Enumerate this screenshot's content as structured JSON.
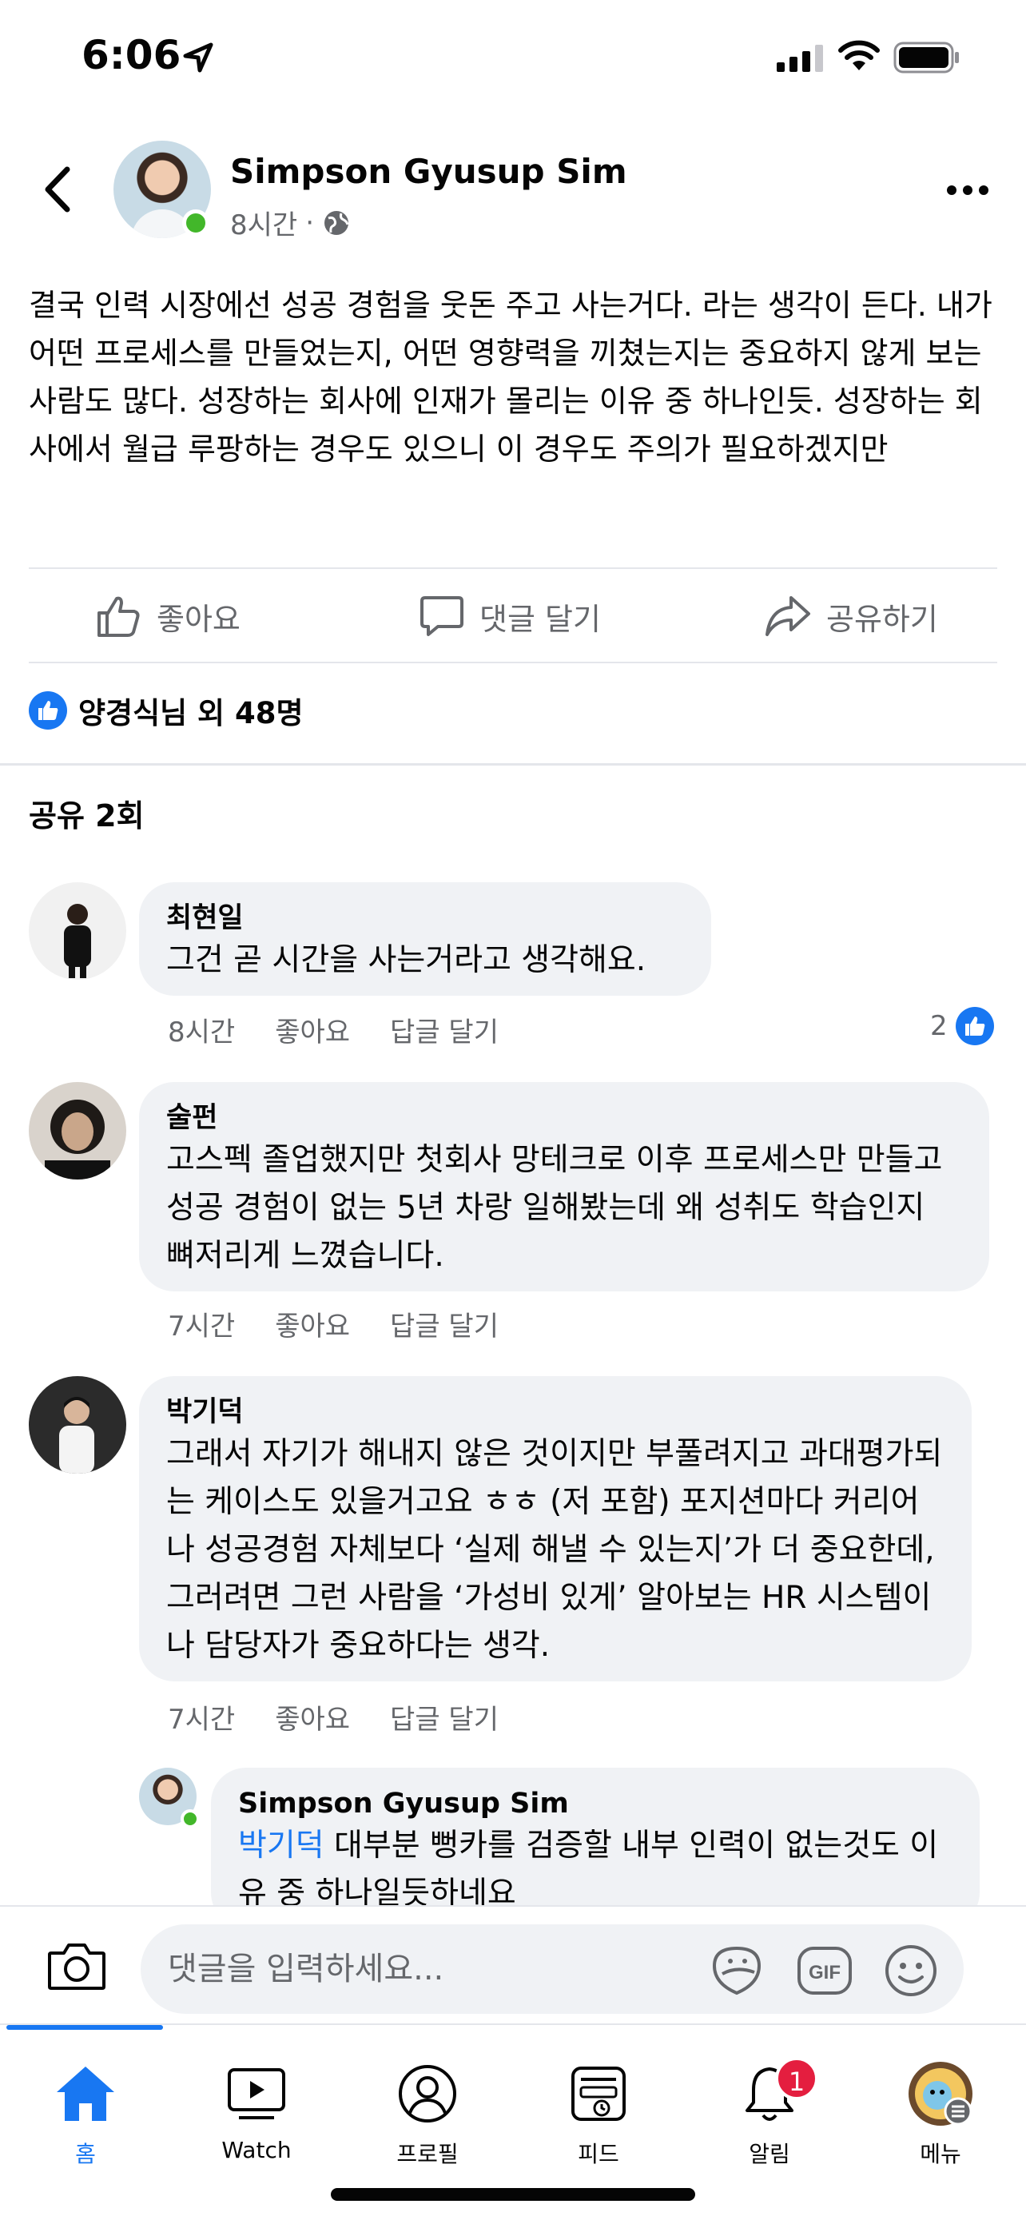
{
  "status_bar": {
    "time": "6:06"
  },
  "post": {
    "author": "Simpson Gyusup Sim",
    "time": "8시간",
    "meta_separator": "·",
    "privacy_icon": "globe-icon",
    "body": "결국 인력 시장에선 성공 경험을 웃돈 주고 사는거다. 라는 생각이 든다. 내가 어떤 프로세스를 만들었는지, 어떤 영향력을 끼쳤는지는 중요하지 않게 보는 사람도 많다. 성장하는 회사에 인재가 몰리는 이유 중 하나인듯. 성장하는 회사에서 월급 루팡하는 경우도 있으니 이 경우도 주의가 필요하겠지만"
  },
  "actions": {
    "like": "좋아요",
    "comment": "댓글 달기",
    "share": "공유하기"
  },
  "reactions": {
    "summary": "양경식님 외 48명"
  },
  "shares": {
    "label": "공유 2회"
  },
  "comments": [
    {
      "name": "최현일",
      "text": "그건 곧 시간을 사는거라고 생각해요.",
      "time": "8시간",
      "like": "좋아요",
      "reply": "답글 달기",
      "reaction_count": "2"
    },
    {
      "name": "술펀",
      "text": "고스펙 졸업했지만 첫회사 망테크로 이후 프로세스만 만들고 성공 경험이 없는 5년 차랑 일해봤는데 왜 성취도 학습인지 뼈저리게 느꼈습니다.",
      "time": "7시간",
      "like": "좋아요",
      "reply": "답글 달기"
    },
    {
      "name": "박기덕",
      "text": "그래서 자기가 해내지 않은 것이지만 부풀려지고 과대평가되는 케이스도 있을거고요 ㅎㅎ (저 포함) 포지션마다 커리어나 성공경험 자체보다 ‘실제 해낼 수 있는지’가 더 중요한데, 그러려면 그런 사람을 ‘가성비 있게’ 알아보는 HR 시스템이나 담당자가 중요하다는 생각.",
      "time": "7시간",
      "like": "좋아요",
      "reply": "답글 달기"
    }
  ],
  "reply": {
    "name": "Simpson Gyusup Sim",
    "mention": "박기덕",
    "text": " 대부분 뻥카를 검증할 내부 인력이 없는것도 이유 중 하나일듯하네요"
  },
  "input": {
    "placeholder": "댓글을 입력하세요..."
  },
  "tabs": [
    {
      "label": "홈",
      "icon": "home-icon",
      "active": true
    },
    {
      "label": "Watch",
      "icon": "watch-icon"
    },
    {
      "label": "프로필",
      "icon": "profile-icon"
    },
    {
      "label": "피드",
      "icon": "feed-icon"
    },
    {
      "label": "알림",
      "icon": "bell-icon",
      "badge": "1"
    },
    {
      "label": "메뉴",
      "icon": "menu-avatar-icon"
    }
  ],
  "colors": {
    "accent": "#1877f2",
    "bubble": "#f0f2f5",
    "secondary_text": "#65676b",
    "online": "#42b72a",
    "badge": "#e41e3f"
  }
}
